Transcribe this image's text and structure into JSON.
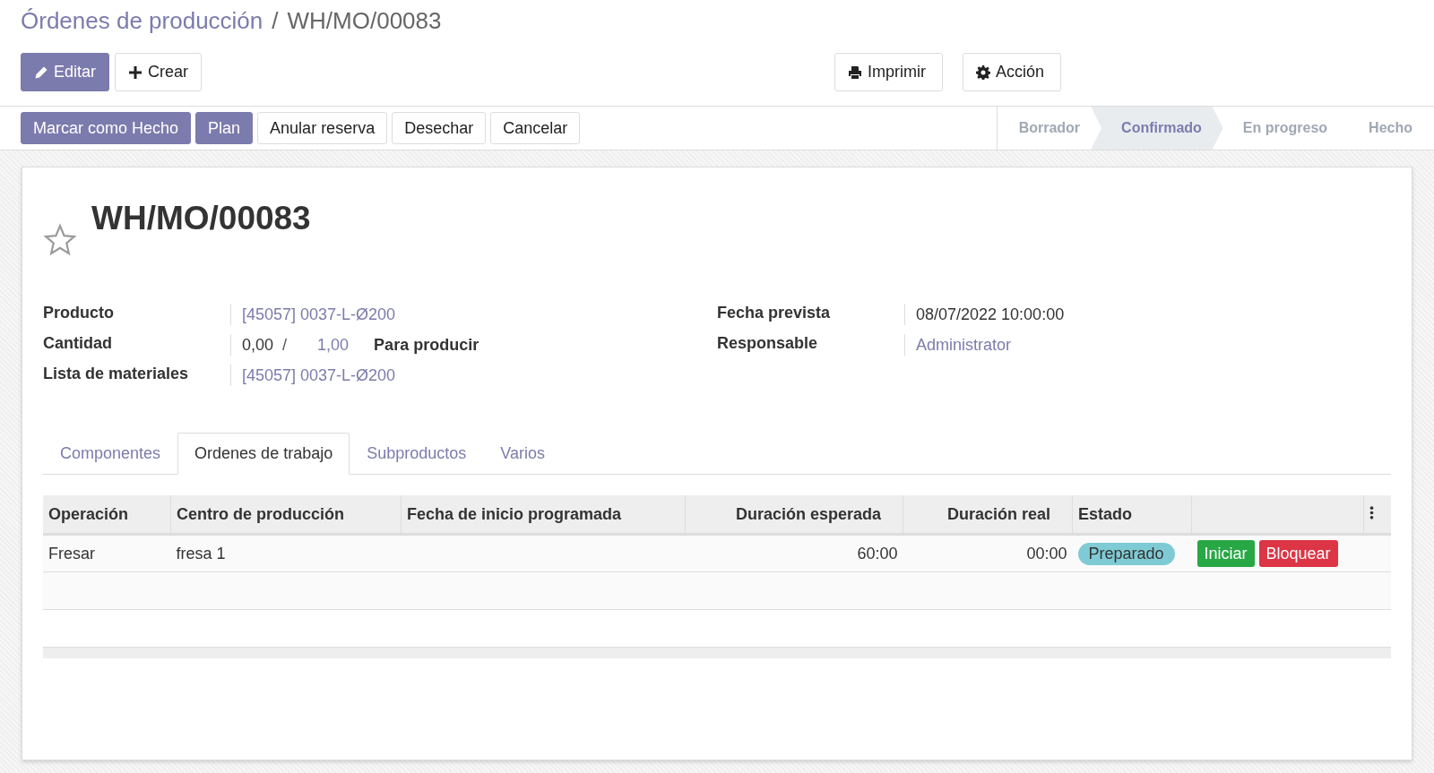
{
  "breadcrumb": {
    "parent": "Órdenes de producción",
    "separator": "/",
    "current": "WH/MO/00083"
  },
  "main_buttons": [
    {
      "label": "Editar",
      "kind": "primary"
    },
    {
      "label": "Crear",
      "kind": "secondary"
    }
  ],
  "toolbar_menus": [
    {
      "label": "Imprimir"
    },
    {
      "label": "Acción"
    }
  ],
  "action_buttons": [
    {
      "label": "Marcar como Hecho",
      "kind": "primary"
    },
    {
      "label": "Plan",
      "kind": "primary"
    },
    {
      "label": "Anular reserva",
      "kind": "secondary"
    },
    {
      "label": "Desechar",
      "kind": "secondary"
    },
    {
      "label": "Cancelar",
      "kind": "secondary"
    }
  ],
  "stages": [
    {
      "label": "Borrador",
      "selected": false
    },
    {
      "label": "Confirmado",
      "selected": true
    },
    {
      "label": "En progreso",
      "selected": false
    },
    {
      "label": "Hecho",
      "selected": false
    }
  ],
  "record": {
    "title": "WH/MO/00083",
    "starred": false
  },
  "left_fields": [
    {
      "label": "Producto",
      "kind": "link",
      "value": "[45057] 0037-L-Ø200"
    },
    {
      "label": "Cantidad",
      "kind": "quantity",
      "produced": "0,00",
      "separator": "/",
      "planned": "1,00",
      "suffix": "Para producir"
    },
    {
      "label": "Lista de materiales",
      "kind": "link",
      "value": "[45057] 0037-L-Ø200"
    }
  ],
  "right_fields": [
    {
      "label": "Fecha prevista",
      "kind": "text",
      "value": "08/07/2022 10:00:00"
    },
    {
      "label": "Responsable",
      "kind": "link",
      "value": "Administrator"
    }
  ],
  "tabs": [
    {
      "label": "Componentes",
      "selected": false
    },
    {
      "label": "Ordenes de trabajo",
      "selected": true
    },
    {
      "label": "Subproductos",
      "selected": false
    },
    {
      "label": "Varios",
      "selected": false
    }
  ],
  "table": {
    "columns": [
      "Operación",
      "Centro de producción",
      "Fecha de inicio programada",
      "Duración esperada",
      "Duración real",
      "Estado"
    ],
    "rows": [
      {
        "operation": "Fresar",
        "workcenter": "fresa 1",
        "expected": "60:00",
        "real": "00:00",
        "status": {
          "label": "Preparado",
          "color": "#7fcbd5"
        },
        "buttons": [
          {
            "label": "Iniciar",
            "color": "#28a745"
          },
          {
            "label": "Bloquear",
            "color": "#dc3545"
          }
        ]
      }
    ]
  }
}
